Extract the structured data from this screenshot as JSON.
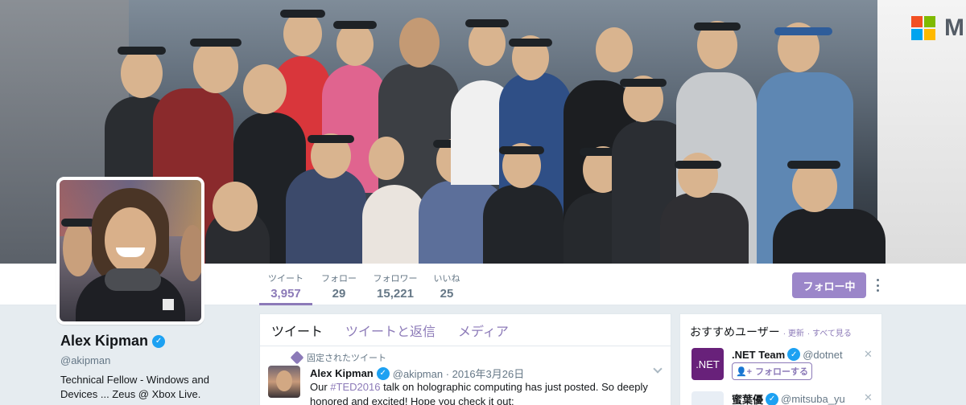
{
  "profile": {
    "name": "Alex Kipman",
    "handle": "@akipman",
    "bio": "Technical Fellow - Windows and Devices ... Zeus @ Xbox Live."
  },
  "stats": [
    {
      "label": "ツイート",
      "value": "3,957"
    },
    {
      "label": "フォロー",
      "value": "29"
    },
    {
      "label": "フォロワー",
      "value": "15,221"
    },
    {
      "label": "いいね",
      "value": "25"
    }
  ],
  "actions": {
    "following_label": "フォロー中"
  },
  "timeline": {
    "tabs": [
      "ツイート",
      "ツイートと返信",
      "メディア"
    ],
    "pinned_label": "固定されたツイート",
    "tweet": {
      "name": "Alex Kipman",
      "meta": "@akipman · 2016年3月26日",
      "text_before": "Our ",
      "hashtag": "#TED2016",
      "text_after": " talk on holographic computing has just posted. So deeply honored and excited! Hope you check it out:"
    }
  },
  "suggestions": {
    "title": "おすすめユーザー",
    "refresh": "· 更新",
    "view_all": "· すべて見る",
    "users": [
      {
        "name": ".NET Team",
        "handle": "@dotnet",
        "avatar_text": ".NET",
        "follow_label": "フォローする"
      },
      {
        "name": "蜜葉優",
        "handle": "@mitsuba_yu"
      }
    ]
  },
  "header_brand": {
    "text": "M",
    "colors": [
      "#f25022",
      "#7fba00",
      "#00a4ef",
      "#ffb900"
    ]
  },
  "accent_color": "#8c7ab8",
  "icons": [
    "verified-icon",
    "pin-icon",
    "more-icon",
    "chevron-down-icon",
    "close-icon",
    "add-user-icon"
  ]
}
